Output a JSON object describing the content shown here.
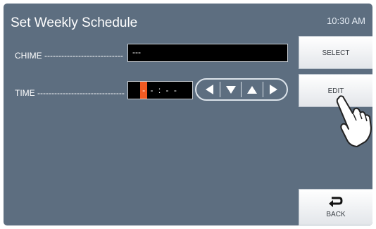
{
  "header": {
    "title": "Set Weekly Schedule",
    "time": "10:30 AM"
  },
  "rows": {
    "chime": {
      "label": "CHIME ----------------------------",
      "value": "---"
    },
    "time": {
      "label": "TIME -------------------------------",
      "value": "- - : - -"
    }
  },
  "arrows": [
    "left-arrow-icon",
    "down-arrow-icon",
    "up-arrow-icon",
    "right-arrow-icon"
  ],
  "buttons": {
    "select": "SELECT",
    "edit": "EDIT",
    "back": "BACK"
  },
  "colors": {
    "screen_background": "#5d6e80",
    "field_background": "#000000",
    "cursor_highlight": "#f15a22",
    "button_text": "#3a3f45"
  }
}
